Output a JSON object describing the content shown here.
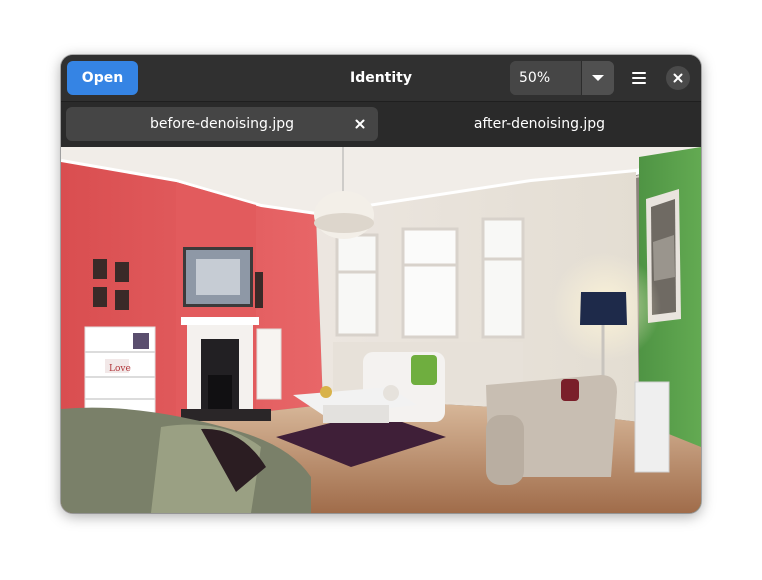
{
  "window": {
    "title": "Identity"
  },
  "header": {
    "open_label": "Open",
    "zoom_value": "50%"
  },
  "tabs": [
    {
      "label": "before-denoising.jpg",
      "active": true
    },
    {
      "label": "after-denoising.jpg",
      "active": false
    }
  ],
  "photo": {
    "sign_text": "Love",
    "colors": {
      "red_wall": "#e45a5c",
      "green_wall": "#58a04a",
      "floor": "#b98865",
      "ceiling": "#f1ede8",
      "accent": "#3584e4"
    }
  }
}
